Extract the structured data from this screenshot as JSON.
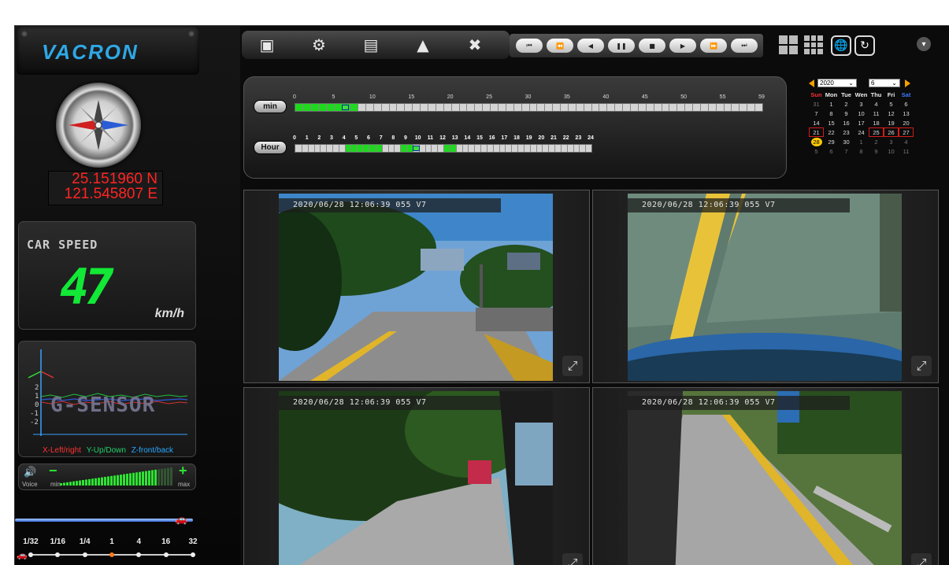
{
  "brand": {
    "logo_text": "VACRON"
  },
  "gps": {
    "latitude": "25.151960 N",
    "longitude": "121.545807 E"
  },
  "speed": {
    "title": "CAR SPEED",
    "value": "47",
    "unit": "km/h"
  },
  "gsensor": {
    "watermark": "G-SENSOR",
    "y_ticks": [
      "2",
      "1",
      "0",
      "-1",
      "-2"
    ],
    "legend_x": "X-Left/right",
    "legend_y": "Y-Up/Down",
    "legend_z": "Z-front/back"
  },
  "volume": {
    "icon_label": "Voice",
    "minus": "−",
    "plus": "+",
    "min_label": "min",
    "max_label": "max",
    "level": 0.85
  },
  "playback_speed": {
    "labels": [
      "1/32",
      "1/16",
      "1/4",
      "1",
      "4",
      "16",
      "32"
    ],
    "selected_index": 3
  },
  "toolbar": {
    "tools": [
      {
        "name": "snapshot",
        "icon": "camera-icon"
      },
      {
        "name": "settings",
        "icon": "gears-icon"
      },
      {
        "name": "save",
        "icon": "floppy-icon"
      },
      {
        "name": "export",
        "icon": "tray-upload-icon"
      },
      {
        "name": "tools",
        "icon": "wrench-screwdriver-icon"
      }
    ],
    "playback": [
      "first",
      "rewind",
      "step-back",
      "pause",
      "stop",
      "play",
      "forward",
      "last"
    ]
  },
  "timeline": {
    "min_label": "min",
    "hour_label": "Hour",
    "min_ticks": [
      "0",
      "5",
      "10",
      "15",
      "20",
      "25",
      "30",
      "35",
      "40",
      "45",
      "50",
      "55",
      "59"
    ],
    "hour_ticks": [
      "0",
      "1",
      "2",
      "3",
      "4",
      "5",
      "6",
      "7",
      "8",
      "9",
      "10",
      "11",
      "12",
      "13",
      "14",
      "15",
      "16",
      "17",
      "18",
      "19",
      "20",
      "21",
      "22",
      "23",
      "24"
    ],
    "min_recorded": [
      [
        0,
        8
      ]
    ],
    "min_cursor": 6,
    "hour_recorded": [
      [
        8,
        14
      ],
      [
        17,
        19
      ],
      [
        24,
        26
      ]
    ],
    "hour_cursor": 19
  },
  "calendar": {
    "year": "2020",
    "month": "6",
    "weekdays": [
      "Sun",
      "Mon",
      "Tue",
      "Wen",
      "Thu",
      "Fri",
      "Sat"
    ],
    "weeks": [
      [
        "31",
        "1",
        "2",
        "3",
        "4",
        "5",
        "6"
      ],
      [
        "7",
        "8",
        "9",
        "10",
        "11",
        "12",
        "13"
      ],
      [
        "14",
        "15",
        "16",
        "17",
        "18",
        "19",
        "20"
      ],
      [
        "21",
        "22",
        "23",
        "24",
        "25",
        "26",
        "27"
      ],
      [
        "28",
        "29",
        "30",
        "1",
        "2",
        "3",
        "4"
      ],
      [
        "5",
        "6",
        "7",
        "8",
        "9",
        "10",
        "11"
      ]
    ],
    "recorded_days": [
      "21",
      "25",
      "26",
      "27"
    ],
    "today": "28"
  },
  "videos": [
    {
      "osd": "2020/06/28 12:06:39 055 V7"
    },
    {
      "osd": "2020/06/28 12:06:39 055 V7"
    },
    {
      "osd": "2020/06/28 12:06:39 055 V7"
    },
    {
      "osd": "2020/06/28 12:06:39 055 V7"
    }
  ]
}
